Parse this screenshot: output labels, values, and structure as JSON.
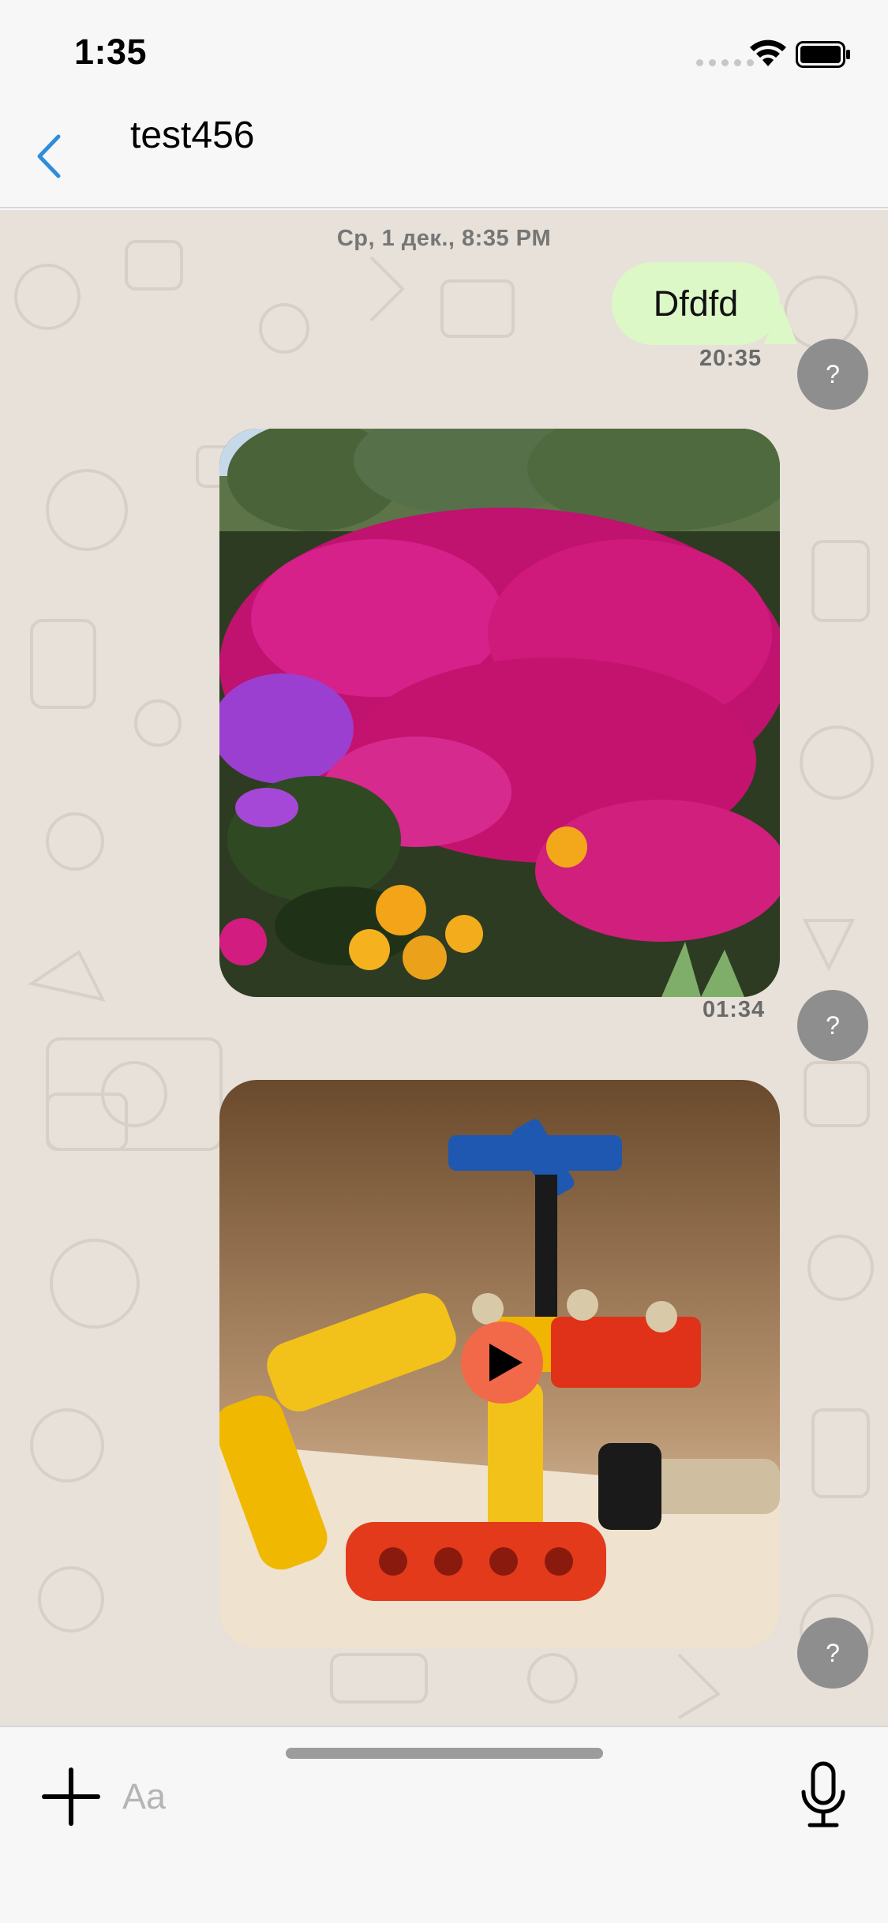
{
  "status_bar": {
    "time": "1:35",
    "wifi_icon": "wifi-icon",
    "battery_icon": "battery-icon"
  },
  "nav": {
    "back_icon": "chevron-left-icon",
    "title": "test456"
  },
  "chat": {
    "date_separator": "Ср, 1 дек., 8:35 PM",
    "messages": [
      {
        "type": "text",
        "text": "Dfdfd",
        "time": "20:35",
        "avatar": "?"
      },
      {
        "type": "image",
        "subject": "flowers-photo",
        "time": "01:34",
        "avatar": "?"
      },
      {
        "type": "video",
        "subject": "lego-robot-video",
        "play_icon": "play-icon",
        "avatar": "?"
      }
    ]
  },
  "input": {
    "placeholder": "Aa",
    "plus_icon": "plus-icon",
    "mic_icon": "microphone-icon"
  },
  "colors": {
    "accent": "#2e8ddb",
    "outgoing_bubble": "#dcf8c6",
    "chat_background": "#e7e1d9",
    "avatar": "#8e8e8e",
    "play_button": "#f2694a"
  }
}
